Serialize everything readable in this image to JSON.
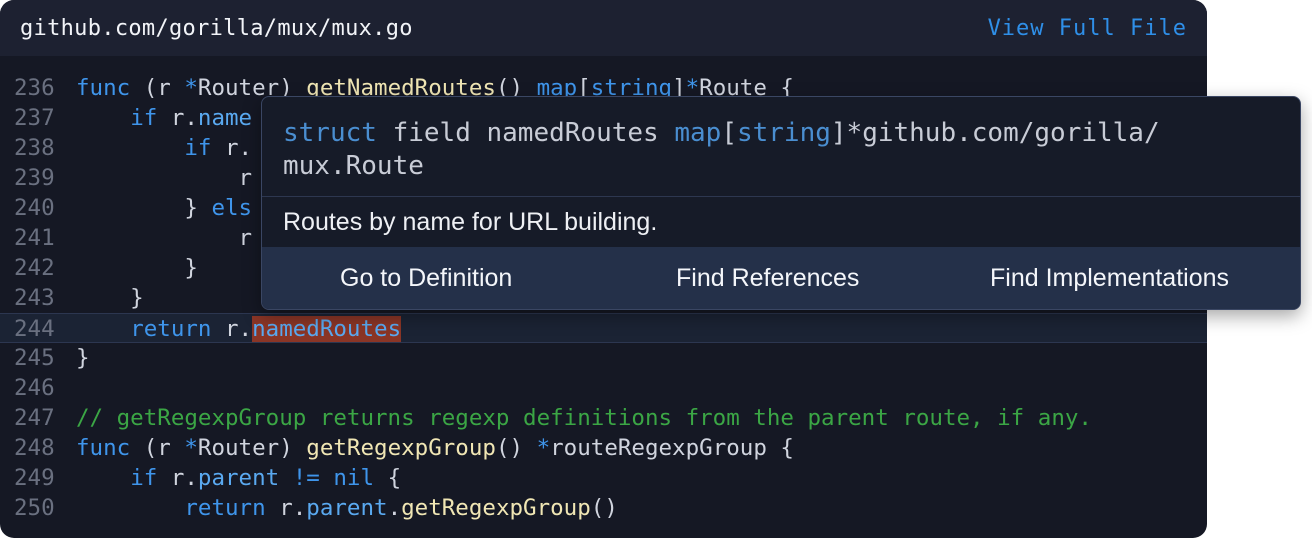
{
  "header": {
    "file_path": "github.com/gorilla/mux/mux.go",
    "view_full_label": "View Full File"
  },
  "code_lines": [
    {
      "n": "236",
      "parts": [
        [
          "kw",
          "func"
        ],
        [
          "p",
          " (r "
        ],
        [
          "kw",
          "*"
        ],
        [
          "p",
          "Router) "
        ],
        [
          "fn",
          "getNamedRoutes"
        ],
        [
          "p",
          "() "
        ],
        [
          "kw",
          "map"
        ],
        [
          "p",
          "["
        ],
        [
          "kw",
          "string"
        ],
        [
          "p",
          "]"
        ],
        [
          "kw",
          "*"
        ],
        [
          "p",
          "Route {"
        ]
      ]
    },
    {
      "n": "237",
      "parts": [
        [
          "p",
          "    "
        ],
        [
          "kw",
          "if"
        ],
        [
          "p",
          " r."
        ],
        [
          "fld",
          "name"
        ]
      ]
    },
    {
      "n": "238",
      "parts": [
        [
          "p",
          "        "
        ],
        [
          "kw",
          "if"
        ],
        [
          "p",
          " r."
        ]
      ]
    },
    {
      "n": "239",
      "parts": [
        [
          "p",
          "            r"
        ]
      ]
    },
    {
      "n": "240",
      "parts": [
        [
          "p",
          "        } "
        ],
        [
          "kw",
          "els"
        ]
      ]
    },
    {
      "n": "241",
      "parts": [
        [
          "p",
          "            r"
        ]
      ]
    },
    {
      "n": "242",
      "parts": [
        [
          "p",
          "        }"
        ]
      ]
    },
    {
      "n": "243",
      "parts": [
        [
          "p",
          "    }"
        ]
      ]
    },
    {
      "n": "244",
      "parts": [
        [
          "p",
          "    "
        ],
        [
          "kw",
          "return"
        ],
        [
          "p",
          " r."
        ],
        [
          "hl",
          "namedRoutes"
        ]
      ],
      "active": true
    },
    {
      "n": "245",
      "parts": [
        [
          "p",
          "}"
        ]
      ]
    },
    {
      "n": "246",
      "parts": []
    },
    {
      "n": "247",
      "parts": [
        [
          "cm",
          "// getRegexpGroup returns regexp definitions from the parent route, if any."
        ]
      ]
    },
    {
      "n": "248",
      "parts": [
        [
          "kw",
          "func"
        ],
        [
          "p",
          " (r "
        ],
        [
          "kw",
          "*"
        ],
        [
          "p",
          "Router) "
        ],
        [
          "fn",
          "getRegexpGroup"
        ],
        [
          "p",
          "() "
        ],
        [
          "kw",
          "*"
        ],
        [
          "p",
          "routeRegexpGroup {"
        ]
      ]
    },
    {
      "n": "249",
      "parts": [
        [
          "p",
          "    "
        ],
        [
          "kw",
          "if"
        ],
        [
          "p",
          " r."
        ],
        [
          "fld",
          "parent"
        ],
        [
          "p",
          " "
        ],
        [
          "kw",
          "!="
        ],
        [
          "p",
          " "
        ],
        [
          "kw",
          "nil"
        ],
        [
          "p",
          " {"
        ]
      ]
    },
    {
      "n": "250",
      "parts": [
        [
          "p",
          "        "
        ],
        [
          "kw",
          "return"
        ],
        [
          "p",
          " r."
        ],
        [
          "fld",
          "parent"
        ],
        [
          "p",
          "."
        ],
        [
          "fn",
          "getRegexpGroup"
        ],
        [
          "p",
          "()"
        ]
      ]
    }
  ],
  "tooltip": {
    "sig_kw1": "struct",
    "sig_mid": " field namedRoutes ",
    "sig_kw2": "map",
    "sig_b1": "[",
    "sig_kw3": "string",
    "sig_rest1": "]*github.com/gorilla/",
    "sig_rest2": "mux.Route",
    "doc": "Routes by name for URL building.",
    "actions": [
      "Go to Definition",
      "Find References",
      "Find Implementations"
    ]
  },
  "colors": {
    "keyword": "#3f95eb",
    "function": "#f0e6b4",
    "comment": "#3ba645",
    "highlight_bg": "#8a3526",
    "link": "#2f8fe8"
  }
}
